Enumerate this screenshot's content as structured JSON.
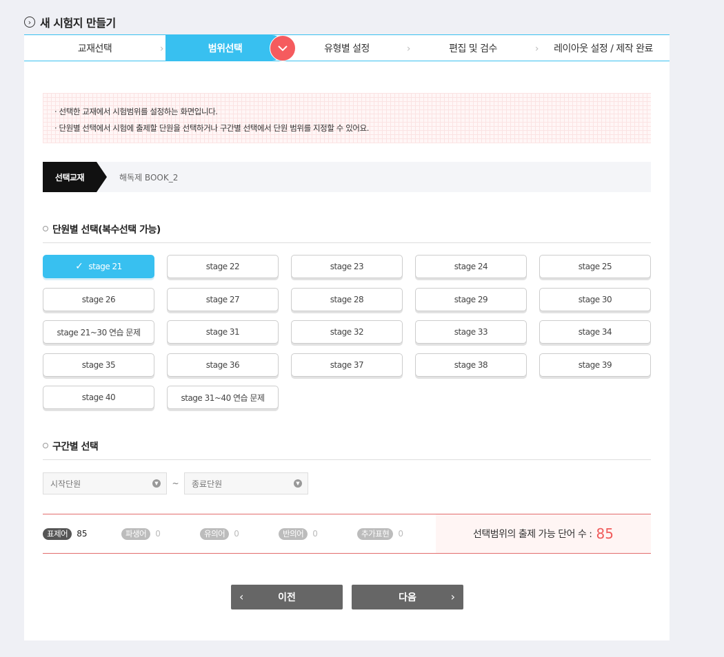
{
  "page_title": "새 시험지 만들기",
  "steps": [
    {
      "label": "교재선택"
    },
    {
      "label": "범위선택"
    },
    {
      "label": "유형별 설정"
    },
    {
      "label": "편집 및 검수"
    },
    {
      "label": "레이아웃 설정 / 제작 완료"
    }
  ],
  "notice": {
    "lines": [
      "· 선택한 교재에서 시험범위를 설정하는 화면입니다.",
      "· 단원별 선택에서 시험에 출제할 단원을 선택하거나 구간별 선택에서 단원 범위를 지정할 수 있어요."
    ]
  },
  "textbook": {
    "tag": "선택교재",
    "name": "해독제 BOOK_2"
  },
  "unit_section": {
    "title": "단원별 선택(복수선택 가능)",
    "units": [
      {
        "label": "stage 21",
        "selected": true
      },
      {
        "label": "stage 22"
      },
      {
        "label": "stage 23"
      },
      {
        "label": "stage 24"
      },
      {
        "label": "stage 25"
      },
      {
        "label": "stage 26"
      },
      {
        "label": "stage 27"
      },
      {
        "label": "stage 28"
      },
      {
        "label": "stage 29"
      },
      {
        "label": "stage 30"
      },
      {
        "label": "stage 21~30 연습 문제"
      },
      {
        "label": "stage 31"
      },
      {
        "label": "stage 32"
      },
      {
        "label": "stage 33"
      },
      {
        "label": "stage 34"
      },
      {
        "label": "stage 35"
      },
      {
        "label": "stage 36"
      },
      {
        "label": "stage 37"
      },
      {
        "label": "stage 38"
      },
      {
        "label": "stage 39"
      },
      {
        "label": "stage 40"
      },
      {
        "label": "stage 31~40 연습 문제"
      }
    ]
  },
  "range_section": {
    "title": "구간별 선택",
    "start_placeholder": "시작단원",
    "separator": "~",
    "end_placeholder": "종료단원"
  },
  "counts": [
    {
      "label": "표제어",
      "value": "85",
      "active": true
    },
    {
      "label": "파생어",
      "value": "0"
    },
    {
      "label": "유의어",
      "value": "0"
    },
    {
      "label": "반의어",
      "value": "0"
    },
    {
      "label": "추가표현",
      "value": "0"
    }
  ],
  "total": {
    "label": "선택범위의 출제 가능 단어 수 :",
    "value": "85"
  },
  "buttons": {
    "prev": "이전",
    "next": "다음"
  },
  "colors": {
    "accent": "#38c0f0",
    "badge": "#f55b5e",
    "total_number": "#f05a5a"
  },
  "icons": {
    "title": "circle-chevron-right-icon",
    "badge": "chevron-down-icon",
    "selected": "check-icon"
  }
}
